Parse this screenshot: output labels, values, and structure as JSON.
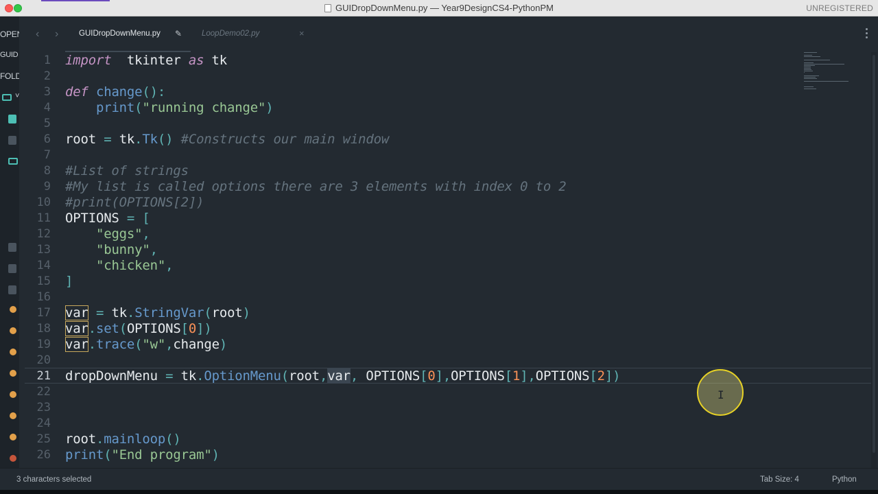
{
  "window": {
    "title": "GUIDropDownMenu.py — Year9DesignCS4-PythonPM",
    "registration": "UNREGISTERED"
  },
  "sidebar": {
    "labels": [
      "OPEN",
      "GUID",
      "FOLD"
    ],
    "item_mark": "˅"
  },
  "tabs": {
    "back_icon": "‹",
    "forward_icon": "›",
    "active": {
      "label": "GUIDropDownMenu.py",
      "modified_icon": "✎"
    },
    "inactive": {
      "label": "LoopDemo02.py",
      "close_icon": "×"
    }
  },
  "editor": {
    "current_line": 21,
    "line_numbers": [
      "1",
      "2",
      "3",
      "4",
      "5",
      "6",
      "7",
      "8",
      "9",
      "10",
      "11",
      "12",
      "13",
      "14",
      "15",
      "16",
      "17",
      "18",
      "19",
      "20",
      "21",
      "22",
      "23",
      "24",
      "25",
      "26"
    ],
    "lines": [
      [
        [
          "kw",
          "import"
        ],
        [
          "",
          "  tkinter "
        ],
        [
          "kw",
          "as"
        ],
        [
          "",
          " tk"
        ]
      ],
      [],
      [
        [
          "kw",
          "def"
        ],
        [
          "",
          " "
        ],
        [
          "fn",
          "change"
        ],
        [
          "bk",
          "():"
        ]
      ],
      [
        [
          "",
          "    "
        ],
        [
          "fn",
          "print"
        ],
        [
          "bk",
          "("
        ],
        [
          "st",
          "\"running change\""
        ],
        [
          "bk",
          ")"
        ]
      ],
      [],
      [
        [
          "",
          "root "
        ],
        [
          "op",
          "="
        ],
        [
          "",
          " tk"
        ],
        [
          "bk",
          "."
        ],
        [
          "fn",
          "Tk"
        ],
        [
          "bk",
          "()"
        ],
        [
          "",
          " "
        ],
        [
          "cm",
          "#Constructs our main window"
        ]
      ],
      [],
      [
        [
          "cm",
          "#List of strings"
        ]
      ],
      [
        [
          "cm",
          "#My list is called options there are 3 elements with index 0 to 2"
        ]
      ],
      [
        [
          "cm",
          "#print(OPTIONS[2])"
        ]
      ],
      [
        [
          "",
          "OPTIONS "
        ],
        [
          "op",
          "="
        ],
        [
          "",
          " "
        ],
        [
          "bk",
          "["
        ]
      ],
      [
        [
          "",
          "    "
        ],
        [
          "st",
          "\"eggs\""
        ],
        [
          "bk",
          ","
        ]
      ],
      [
        [
          "",
          "    "
        ],
        [
          "st",
          "\"bunny\""
        ],
        [
          "bk",
          ","
        ]
      ],
      [
        [
          "",
          "    "
        ],
        [
          "st",
          "\"chicken\""
        ],
        [
          "bk",
          ","
        ]
      ],
      [
        [
          "bk",
          "]"
        ]
      ],
      [],
      [
        [
          "sel",
          "var"
        ],
        [
          "",
          " "
        ],
        [
          "op",
          "="
        ],
        [
          "",
          " tk"
        ],
        [
          "bk",
          "."
        ],
        [
          "fn",
          "StringVar"
        ],
        [
          "bk",
          "("
        ],
        [
          "",
          "root"
        ],
        [
          "bk",
          ")"
        ]
      ],
      [
        [
          "sel",
          "var"
        ],
        [
          "bk",
          "."
        ],
        [
          "fn",
          "set"
        ],
        [
          "bk",
          "("
        ],
        [
          "",
          "OPTIONS"
        ],
        [
          "bk",
          "["
        ],
        [
          "nm",
          "0"
        ],
        [
          "bk",
          "])"
        ]
      ],
      [
        [
          "sel",
          "var"
        ],
        [
          "bk",
          "."
        ],
        [
          "fn",
          "trace"
        ],
        [
          "bk",
          "("
        ],
        [
          "st",
          "\"w\""
        ],
        [
          "bk",
          ","
        ],
        [
          "",
          "change"
        ],
        [
          "bk",
          ")"
        ]
      ],
      [],
      [
        [
          "",
          "dropDownMenu "
        ],
        [
          "op",
          "="
        ],
        [
          "",
          " tk"
        ],
        [
          "bk",
          "."
        ],
        [
          "fn",
          "OptionMenu"
        ],
        [
          "bk",
          "("
        ],
        [
          "",
          "root"
        ],
        [
          "bk",
          ","
        ],
        [
          "selmuted",
          "var"
        ],
        [
          "bk",
          ","
        ],
        [
          "",
          " OPTIONS"
        ],
        [
          "bk",
          "["
        ],
        [
          "nm",
          "0"
        ],
        [
          "bk",
          "],"
        ],
        [
          "",
          "OPTIONS"
        ],
        [
          "bk",
          "["
        ],
        [
          "nm",
          "1"
        ],
        [
          "bk",
          "],"
        ],
        [
          "",
          "OPTIONS"
        ],
        [
          "bk",
          "["
        ],
        [
          "nm",
          "2"
        ],
        [
          "bk",
          "])"
        ]
      ],
      [],
      [],
      [],
      [
        [
          "",
          "root"
        ],
        [
          "bk",
          "."
        ],
        [
          "fn",
          "mainloop"
        ],
        [
          "bk",
          "()"
        ]
      ],
      [
        [
          "fn",
          "print"
        ],
        [
          "bk",
          "("
        ],
        [
          "st",
          "\"End program\""
        ],
        [
          "bk",
          ")"
        ]
      ]
    ]
  },
  "status": {
    "selection": "3 characters selected",
    "tab_size": "Tab Size: 4",
    "syntax": "Python"
  },
  "colors": {
    "background": "#232a31",
    "keyword": "#c594c5",
    "function": "#6699cc",
    "string": "#99c794",
    "comment": "#65737e",
    "number": "#f99157",
    "operator": "#5fb3b3",
    "cursor_highlight": "#e7d226"
  }
}
